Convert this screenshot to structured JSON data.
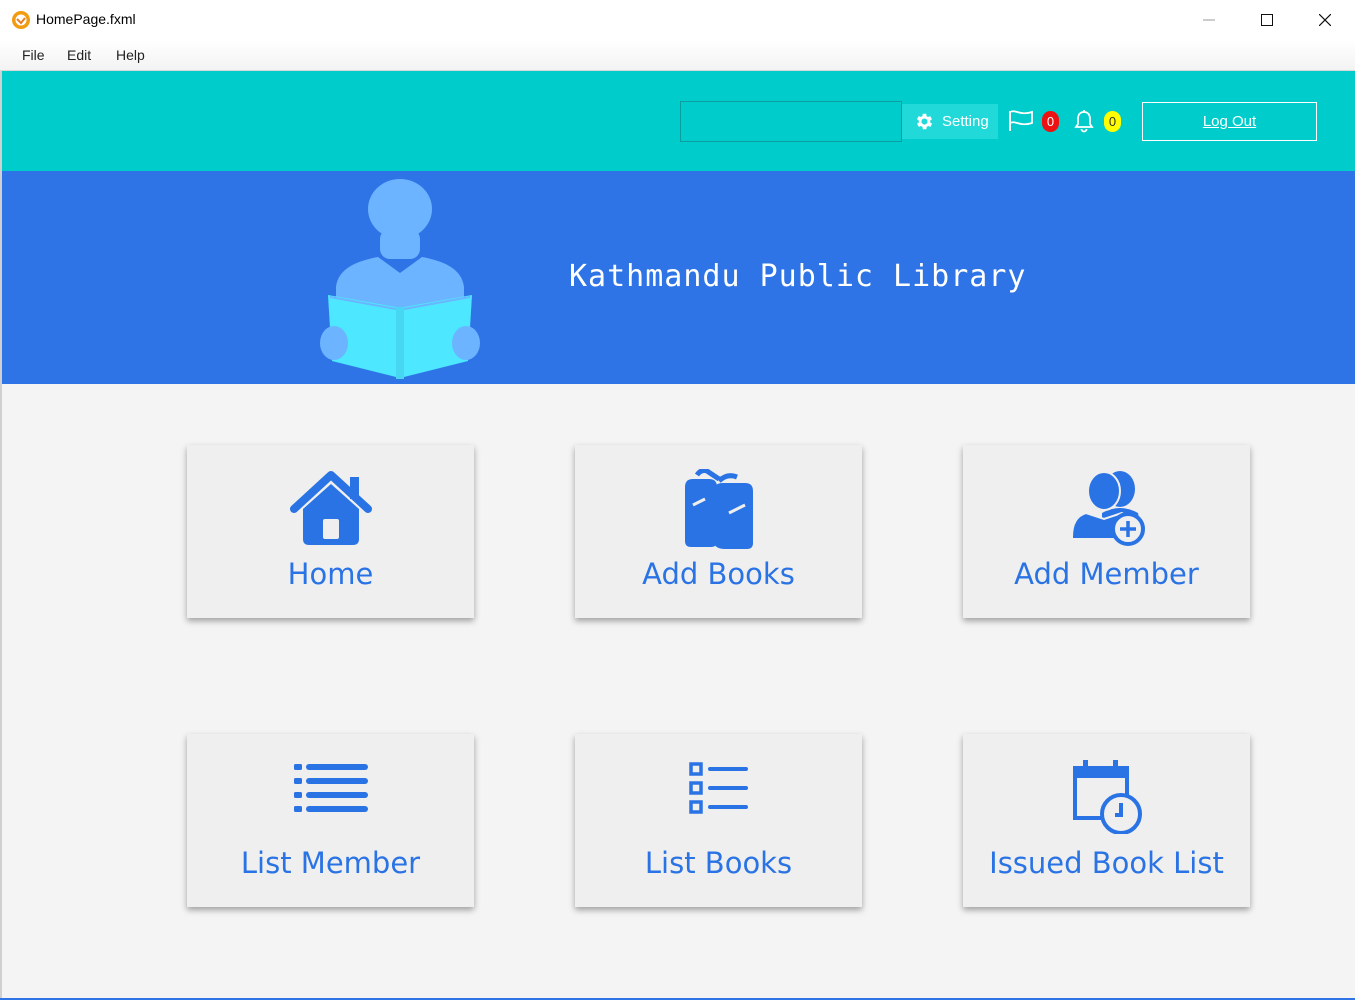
{
  "window": {
    "title": "HomePage.fxml"
  },
  "menu": {
    "items": [
      "File",
      "Edit",
      "Help"
    ]
  },
  "topbar": {
    "search": {
      "value": "",
      "placeholder": ""
    },
    "setting_label": "Setting",
    "flag_count": "0",
    "notification_count": "0",
    "logout_label": "Log Out"
  },
  "banner": {
    "title": "Kathmandu Public Library"
  },
  "tiles": [
    {
      "label": "Home",
      "icon": "home-icon"
    },
    {
      "label": "Add Books",
      "icon": "books-icon"
    },
    {
      "label": "Add Member",
      "icon": "add-member-icon"
    },
    {
      "label": "List Member",
      "icon": "list-icon"
    },
    {
      "label": "List Books",
      "icon": "checklist-icon"
    },
    {
      "label": "Issued Book List",
      "icon": "calendar-clock-icon"
    }
  ],
  "colors": {
    "topbar": "#00cccc",
    "banner": "#2e74e6",
    "accent": "#2a73e4",
    "badge_red": "#ee1111",
    "badge_yellow": "#ffff00"
  }
}
